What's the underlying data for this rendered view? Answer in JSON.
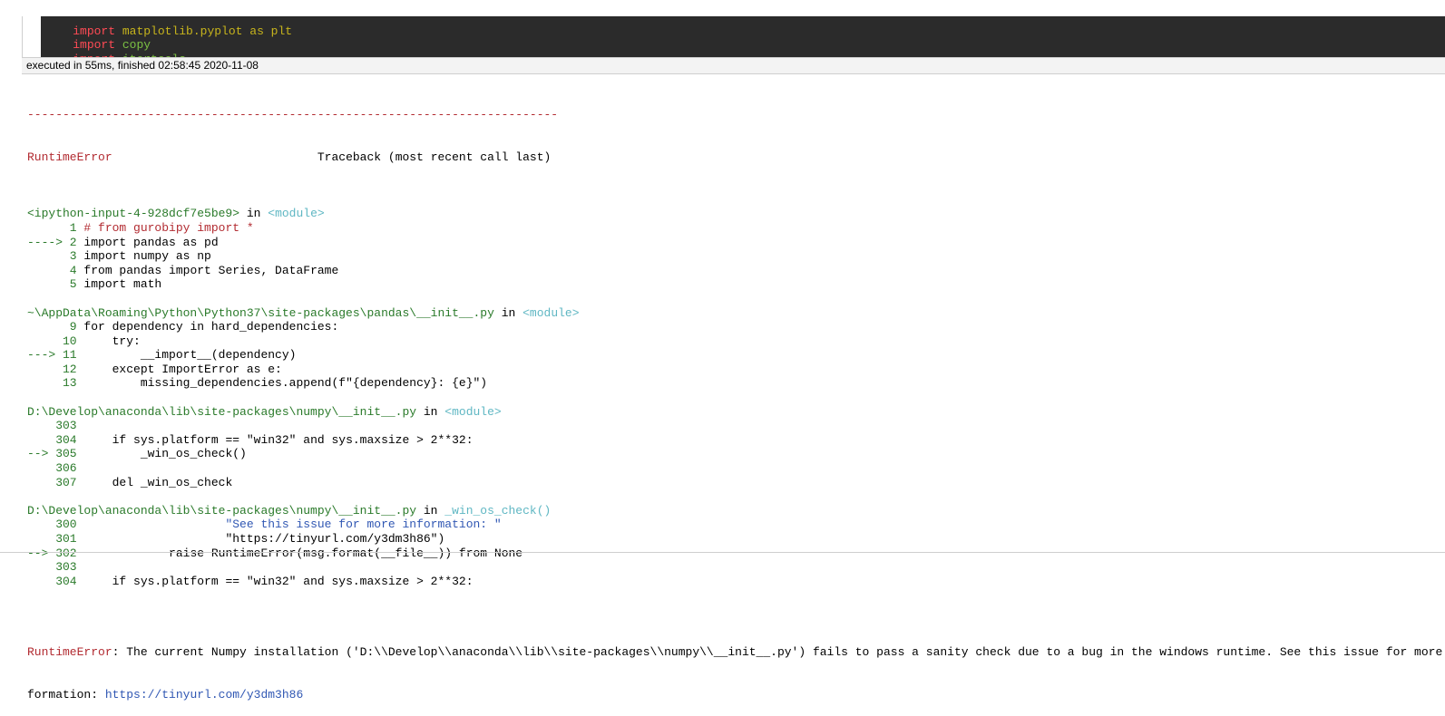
{
  "code_cell": {
    "lines": [
      {
        "keyword": "import",
        "module": "matplotlib.pyplot as plt"
      },
      {
        "keyword": "import",
        "module": "copy"
      },
      {
        "keyword": "import",
        "module": "itertools"
      }
    ]
  },
  "exec_status": "executed in 55ms, finished 02:58:45 2020-11-08",
  "traceback": {
    "separator": "---------------------------------------------------------------------------",
    "error_type": "RuntimeError",
    "header_right": "Traceback (most recent call last)",
    "frames": [
      {
        "file": "<ipython-input-4-928dcf7e5be9>",
        "in_word": " in ",
        "func": "<module>",
        "lines": [
          {
            "gutter": "      1 ",
            "code": "# from gurobipy import *",
            "tone": "red"
          },
          {
            "gutter": "----> 2 ",
            "code": "import pandas as pd",
            "tone": "plain"
          },
          {
            "gutter": "      3 ",
            "code": "import numpy as np",
            "tone": "plain"
          },
          {
            "gutter": "      4 ",
            "code": "from pandas import Series, DataFrame",
            "tone": "plain"
          },
          {
            "gutter": "      5 ",
            "code": "import math",
            "tone": "plain"
          }
        ]
      },
      {
        "file": "~\\AppData\\Roaming\\Python\\Python37\\site-packages\\pandas\\__init__.py",
        "in_word": " in ",
        "func": "<module>",
        "lines": [
          {
            "gutter": "      9 ",
            "code": "for dependency in hard_dependencies:",
            "tone": "plain"
          },
          {
            "gutter": "     10 ",
            "code": "    try:",
            "tone": "plain"
          },
          {
            "gutter": "---> 11 ",
            "code": "        __import__(dependency)",
            "tone": "plain"
          },
          {
            "gutter": "     12 ",
            "code": "    except ImportError as e:",
            "tone": "plain"
          },
          {
            "gutter": "     13 ",
            "code": "        missing_dependencies.append(f\"{dependency}: {e}\")",
            "tone": "plain"
          }
        ]
      },
      {
        "file": "D:\\Develop\\anaconda\\lib\\site-packages\\numpy\\__init__.py",
        "in_word": " in ",
        "func": "<module>",
        "lines": [
          {
            "gutter": "    303 ",
            "code": "",
            "tone": "plain"
          },
          {
            "gutter": "    304 ",
            "code": "    if sys.platform == \"win32\" and sys.maxsize > 2**32:",
            "tone": "plain"
          },
          {
            "gutter": "--> 305 ",
            "code": "        _win_os_check()",
            "tone": "plain"
          },
          {
            "gutter": "    306 ",
            "code": "",
            "tone": "plain"
          },
          {
            "gutter": "    307 ",
            "code": "    del _win_os_check",
            "tone": "plain"
          }
        ]
      },
      {
        "file": "D:\\Develop\\anaconda\\lib\\site-packages\\numpy\\__init__.py",
        "in_word": " in ",
        "func": "_win_os_check()",
        "lines": [
          {
            "gutter": "    300 ",
            "code": "                    \"See this issue for more information: \"",
            "tone": "blue"
          },
          {
            "gutter": "    301 ",
            "code": "                    \"https://tinyurl.com/y3dm3h86\")",
            "tone": "plain"
          },
          {
            "gutter": "--> 302 ",
            "code": "            raise RuntimeError(msg.format(__file__)) from None",
            "tone": "plain"
          },
          {
            "gutter": "    303 ",
            "code": "",
            "tone": "plain"
          },
          {
            "gutter": "    304 ",
            "code": "    if sys.platform == \"win32\" and sys.maxsize > 2**32:",
            "tone": "plain"
          }
        ]
      }
    ],
    "final_error_label": "RuntimeError",
    "final_error_line1": ": The current Numpy installation ('D:\\\\Develop\\\\anaconda\\\\lib\\\\site-packages\\\\numpy\\\\__init__.py') fails to pass a sanity check due to a bug in the windows runtime. See this issue for more in",
    "final_error_line2_prefix": "formation: ",
    "final_error_link": "https://tinyurl.com/y3dm3h86"
  }
}
